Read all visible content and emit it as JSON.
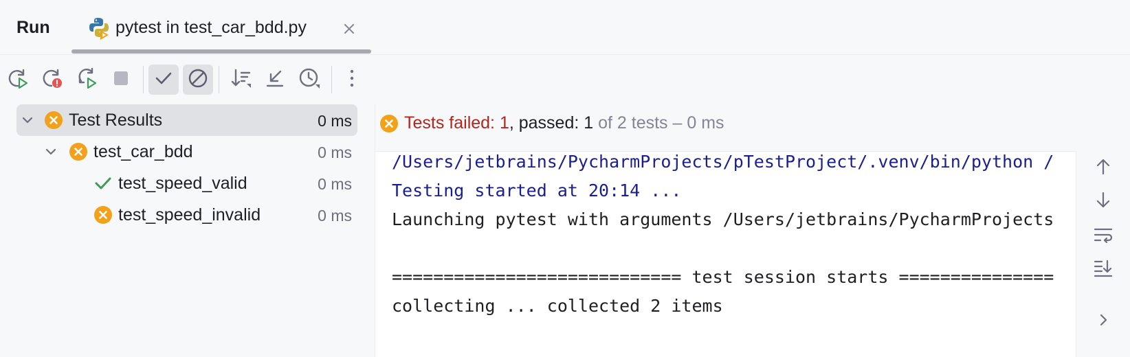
{
  "tabbar": {
    "run_title": "Run",
    "tab_label": "pytest in test_car_bdd.py"
  },
  "toolbar": {
    "buttons": [
      {
        "icon": "rerun-icon"
      },
      {
        "icon": "rerun-failed-icon"
      },
      {
        "icon": "toggle-auto-test-icon"
      },
      {
        "icon": "stop-icon"
      },
      {
        "icon": "show-passed-icon",
        "active": true
      },
      {
        "icon": "show-ignored-icon",
        "active": true
      },
      {
        "icon": "sort-icon"
      },
      {
        "icon": "collapse-all-icon"
      },
      {
        "icon": "test-history-icon"
      },
      {
        "icon": "more-options-icon"
      }
    ]
  },
  "tree": {
    "rows": [
      {
        "label": "Test Results",
        "duration": "0 ms",
        "status": "failed"
      },
      {
        "label": "test_car_bdd",
        "duration": "0 ms",
        "status": "failed"
      },
      {
        "label": "test_speed_valid",
        "duration": "0 ms",
        "status": "passed"
      },
      {
        "label": "test_speed_invalid",
        "duration": "0 ms",
        "status": "failed"
      }
    ]
  },
  "status": {
    "failed_text": "Tests failed: 1",
    "passed_text": ", passed: 1",
    "total_text": " of 2 tests – 0 ms"
  },
  "console": {
    "lines": [
      "/Users/jetbrains/PycharmProjects/pTestProject/.venv/bin/python /",
      "Testing started at 20:14 ...",
      "Launching pytest with arguments /Users/jetbrains/PycharmProjects",
      "",
      "============================ test session starts ===============",
      "collecting ... collected 2 items"
    ]
  },
  "colors": {
    "failed_orange": "#f2a11b",
    "passed_green": "#3e9b57",
    "failed_text": "#b3261e",
    "console_blue": "#1a1f8f"
  }
}
